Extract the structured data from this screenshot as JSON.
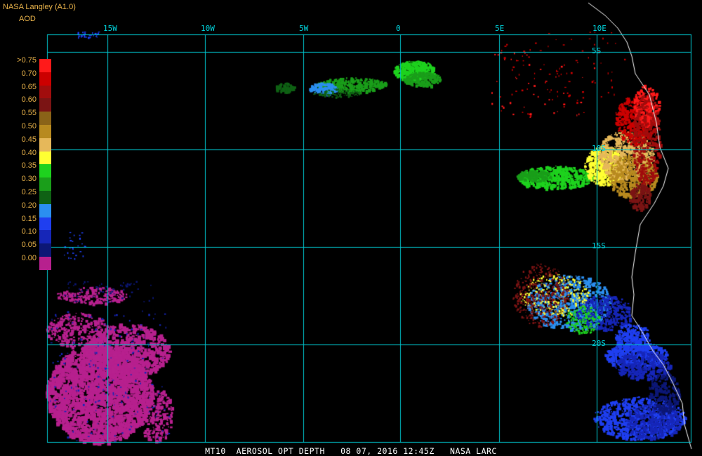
{
  "header": {
    "title": "NASA Langley (A1.0)",
    "param": "AOD"
  },
  "legend": {
    "entries": [
      {
        "label": ">0.75",
        "color": "#ff1a1a"
      },
      {
        "label": "0.70",
        "color": "#cc0000"
      },
      {
        "label": "0.65",
        "color": "#a10d0d"
      },
      {
        "label": "0.60",
        "color": "#7b1414"
      },
      {
        "label": "0.55",
        "color": "#8a6318"
      },
      {
        "label": "0.50",
        "color": "#b88a1f"
      },
      {
        "label": "0.45",
        "color": "#e6b85a"
      },
      {
        "label": "0.40",
        "color": "#ffff33"
      },
      {
        "label": "0.35",
        "color": "#1ed21e"
      },
      {
        "label": "0.30",
        "color": "#1a9e1a"
      },
      {
        "label": "0.25",
        "color": "#0f6114"
      },
      {
        "label": "0.20",
        "color": "#2b8ff0"
      },
      {
        "label": "0.15",
        "color": "#1f3ff0"
      },
      {
        "label": "0.10",
        "color": "#1626b8"
      },
      {
        "label": "0.05",
        "color": "#0c1776"
      },
      {
        "label": "0.00",
        "color": "#b7208e"
      }
    ]
  },
  "grid": {
    "color": "#00c8d2",
    "lon_labels": [
      "15W",
      "10W",
      "5W",
      "0",
      "5E",
      "10E"
    ],
    "lat_labels": [
      "5S",
      "10S",
      "15S",
      "20S"
    ]
  },
  "caption": "MT10  AEROSOL OPT DEPTH   08 07, 2016 12:45Z   NASA LARC"
}
